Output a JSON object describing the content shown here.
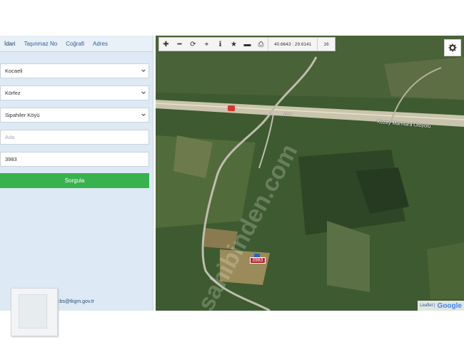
{
  "tabs": [
    "İdari",
    "Taşınmaz No",
    "Coğrafi",
    "Adres"
  ],
  "form": {
    "province": "Kocaeli",
    "district": "Körfez",
    "neighborhood": "Sipahiler Köyü",
    "ada_placeholder": "Ada",
    "parsel_value": "3983",
    "query_label": "Sorgula"
  },
  "contact_email": "cbs@tkgm.gov.tr",
  "toolbar": {
    "coords": "40.6643 : 29.6141",
    "zoom": "16",
    "icons": [
      "zoom-in-icon",
      "zoom-out-icon",
      "refresh-icon",
      "locate-icon",
      "info-icon",
      "star-icon",
      "minus-icon",
      "print-icon"
    ]
  },
  "map": {
    "road_label": "Kuzey Marmara Otoyolu",
    "highway_code": "O-7",
    "parcel_label": "3983",
    "attribution_leaflet": "Leaflet |",
    "attribution_google": "Google",
    "watermark": "sahibinden.com"
  },
  "colors": {
    "accent_green": "#37b24d",
    "panel_bg": "#dde9f4",
    "tab_text": "#2f5f97"
  }
}
